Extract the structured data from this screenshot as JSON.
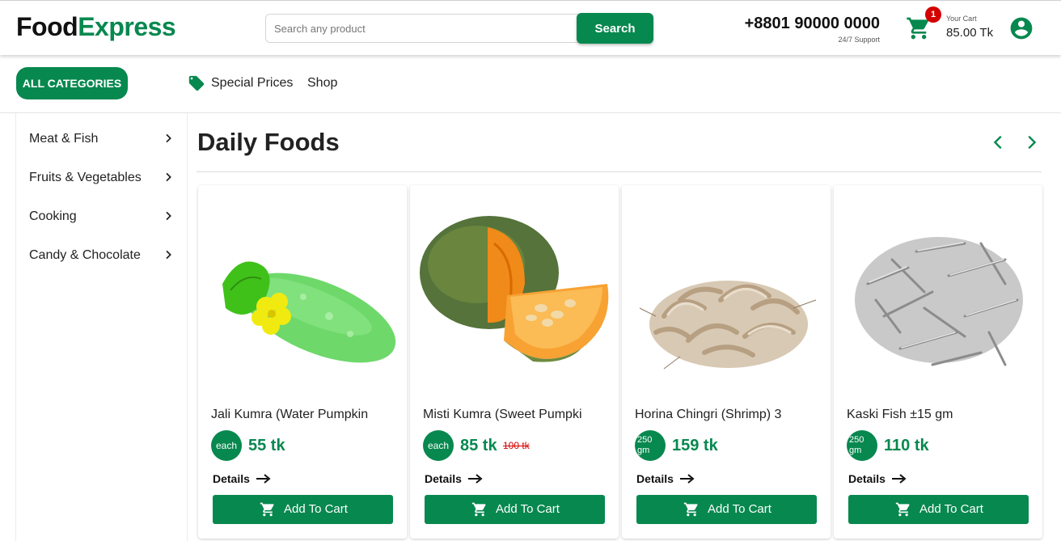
{
  "header": {
    "logo_part1": "Food",
    "logo_part2": "Express",
    "search_placeholder": "Search any product",
    "search_button": "Search",
    "phone": "+8801 90000 0000",
    "support": "24/7 Support",
    "cart_count": "1",
    "cart_label": "Your Cart",
    "cart_total": "85.00 Tk"
  },
  "nav": {
    "all_categories": "ALL CATEGORIES",
    "special_prices": "Special Prices",
    "shop": "Shop"
  },
  "sidebar": {
    "items": [
      {
        "label": "Meat & Fish"
      },
      {
        "label": "Fruits & Vegetables"
      },
      {
        "label": "Cooking"
      },
      {
        "label": "Candy & Chocolate"
      }
    ]
  },
  "section": {
    "title": "Daily Foods"
  },
  "products": [
    {
      "name": "Jali Kumra (Water Pumpkin",
      "unit": "each",
      "price": "55 tk",
      "old_price": "",
      "details": "Details",
      "add": "Add To Cart"
    },
    {
      "name": "Misti Kumra (Sweet Pumpki",
      "unit": "each",
      "price": "85 tk",
      "old_price": "100 tk",
      "details": "Details",
      "add": "Add To Cart"
    },
    {
      "name": "Horina Chingri (Shrimp) 3",
      "unit": "250 gm",
      "price": "159 tk",
      "old_price": "",
      "details": "Details",
      "add": "Add To Cart"
    },
    {
      "name": "Kaski Fish ±15 gm",
      "unit": "250 gm",
      "price": "110 tk",
      "old_price": "",
      "details": "Details",
      "add": "Add To Cart"
    }
  ],
  "colors": {
    "brand_green": "#07884f",
    "badge_red": "#d40000"
  },
  "icons": [
    "cart-icon",
    "user-icon",
    "tag-icon",
    "chevron-right-icon",
    "arrow-left-icon",
    "arrow-right-icon",
    "arrow-right-long-icon"
  ]
}
